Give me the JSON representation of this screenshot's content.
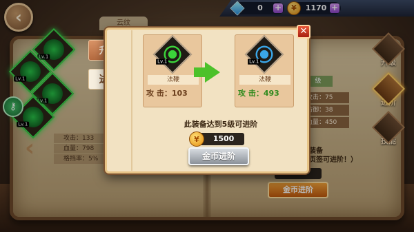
{
  "currency": {
    "gems": "0",
    "gold": "1170",
    "plus": "+"
  },
  "background": {
    "cloud_tab": "云纹",
    "left_stats": [
      "攻击：133",
      "血量：798",
      "格挡率：5%"
    ],
    "right_grade": "级",
    "right_stats": [
      "攻击：75",
      "防御：38",
      "血量：450"
    ],
    "right_text_line1": "装备",
    "right_text_line2": "页签可进阶！）",
    "right_button": "金币进阶"
  },
  "left_equip_levels": [
    "Lv.1",
    "Lv.1",
    "Lv.1",
    "Lv.1"
  ],
  "side_nav": [
    {
      "label": "升级"
    },
    {
      "label": "进阶"
    },
    {
      "label": "技能"
    }
  ],
  "modal": {
    "tabs": [
      {
        "label": "升 级"
      },
      {
        "label": "进 阶"
      }
    ],
    "current": {
      "level": "Lv.1",
      "name": "法鞭",
      "stat": "攻 击：103",
      "color": "#3bd43a"
    },
    "next": {
      "level": "Lv.1",
      "name": "法鞭",
      "stat": "攻 击：493",
      "color": "#3aa6e8"
    },
    "requirement": "此装备达到5级可进阶",
    "cost": "1500",
    "button": "金币进阶"
  },
  "icons": {
    "back": "chevron-left-icon",
    "close": "close-icon",
    "gem": "diamond-icon",
    "coin": "gold-coin-icon",
    "key": "key-icon"
  }
}
